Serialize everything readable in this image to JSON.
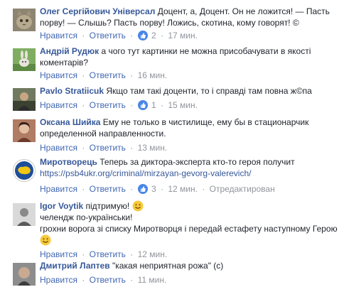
{
  "actions": {
    "like": "Нравится",
    "reply": "Ответить",
    "sep": "·",
    "edited": "Отредактирован"
  },
  "comments": [
    {
      "author": "Олег Сергійович Універсал",
      "lines": [
        "Доцент, а, Доцент. Он не ложится! — Пасть",
        "порву! — Слышь? Пасть порву! Ложись, скотина, кому говорят! ©"
      ],
      "reactions": "2",
      "time": "17 мин."
    },
    {
      "author": "Андрій Рудюк",
      "lines": [
        "а чого тут картинки не можна присобачувати в якості",
        "коментарів?"
      ],
      "time": "16 мин."
    },
    {
      "author": "Pavlo Stratiicuk",
      "lines": [
        "Якщо там такі доценти, то і справді там повна ж©па"
      ],
      "reactions": "1",
      "time": "15 мин."
    },
    {
      "author": "Оксана Шийка",
      "lines": [
        "Ему не только в чистилище, ему бы в стационарчик",
        "определенной направленности."
      ],
      "time": "13 мин."
    },
    {
      "author": "Миротворець",
      "lines": [
        "Теперь за диктора-эксперта кто-то героя получит"
      ],
      "link": "https://psb4ukr.org/criminal/mirzayan-gevorg-valerevich/",
      "reactions": "3",
      "time": "12 мин."
    },
    {
      "author": "Igor Voytik",
      "lines": [
        "підтримую!",
        "челендж по-українськи!",
        "грохни ворога зі списку Миротворця і передай естафету наступному Герою"
      ],
      "time": "12 мин."
    },
    {
      "author": "Дмитрий Лаптев",
      "lines": [
        "\"какая неприятная рожа\" (с)"
      ],
      "time": "11 мин."
    }
  ],
  "colors": {
    "link": "#365899",
    "action": "#4267b2",
    "meta": "#90949c",
    "text": "#1d2129",
    "like_badge": "#4a86e8",
    "emoji": "#f7c93c"
  },
  "icons": {
    "like": "thumbs-up-icon",
    "emoji": "smiley-icon"
  }
}
